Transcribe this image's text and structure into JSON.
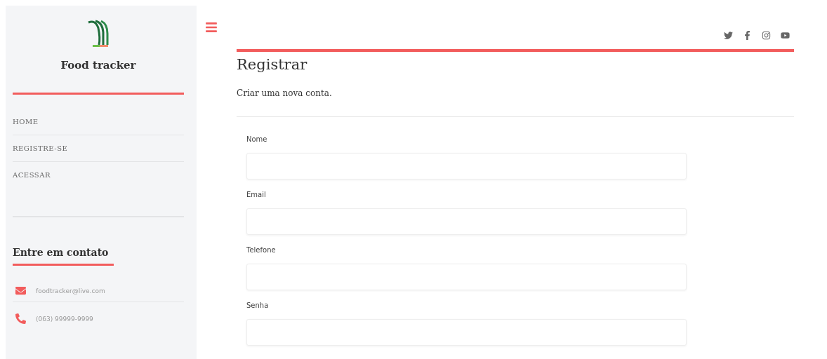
{
  "sidebar": {
    "brand": "Food tracker",
    "nav": [
      {
        "label": "HOME"
      },
      {
        "label": "REGISTRE-SE"
      },
      {
        "label": "ACESSAR"
      }
    ],
    "contact": {
      "title": "Entre em contato",
      "items": [
        {
          "kind": "email",
          "text": "foodtracker@live.com"
        },
        {
          "kind": "phone",
          "text": "(063) 99999-9999"
        }
      ]
    }
  },
  "social": [
    {
      "kind": "twitter"
    },
    {
      "kind": "facebook"
    },
    {
      "kind": "instagram"
    },
    {
      "kind": "youtube"
    }
  ],
  "page": {
    "title": "Registrar",
    "subtitle": "Criar uma nova conta.",
    "fields": [
      {
        "label": "Nome"
      },
      {
        "label": "Email"
      },
      {
        "label": "Telefone"
      },
      {
        "label": "Senha"
      }
    ]
  }
}
